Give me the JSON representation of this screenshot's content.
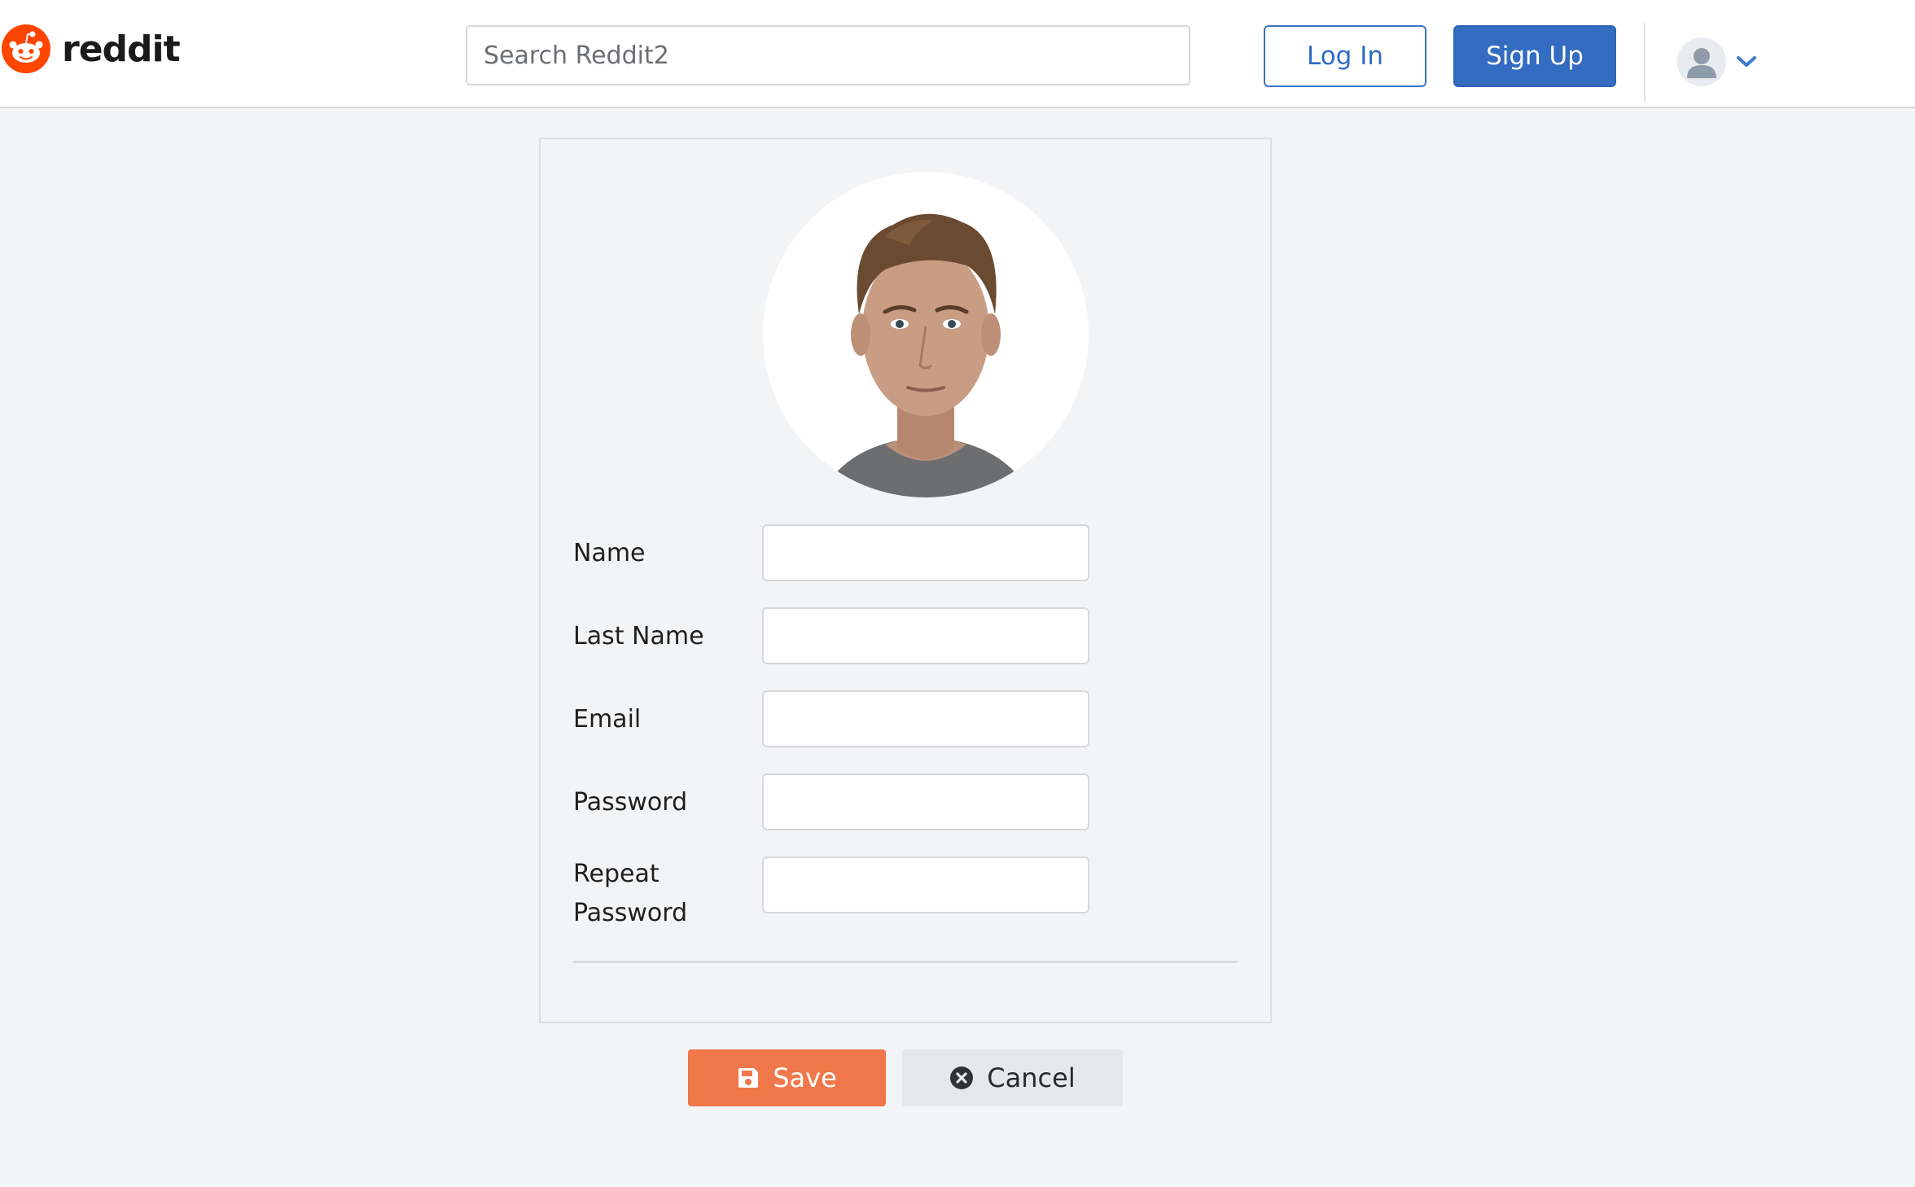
{
  "brand": {
    "wordmark": "reddit",
    "color": "#ff4500"
  },
  "header": {
    "search_placeholder": "Search Reddit2",
    "login_label": "Log In",
    "signup_label": "Sign Up",
    "user_icon": "user-avatar-icon",
    "menu_icon": "chevron-down-icon",
    "accent": "#336cc0"
  },
  "form": {
    "photo_alt": "Profile photo",
    "fields": [
      {
        "label": "Name",
        "value": ""
      },
      {
        "label": "Last Name",
        "value": ""
      },
      {
        "label": "Email",
        "value": ""
      },
      {
        "label": "Password",
        "value": ""
      },
      {
        "label": "Repeat Password",
        "value": ""
      }
    ]
  },
  "actions": {
    "save_label": "Save",
    "save_icon": "floppy-disk-icon",
    "save_color": "#ef774a",
    "cancel_label": "Cancel",
    "cancel_icon": "close-circle-icon"
  }
}
